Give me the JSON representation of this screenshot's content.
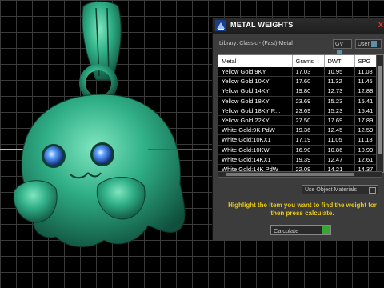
{
  "panel": {
    "title": "METAL WEIGHTS",
    "library": "Library: Classic - (Fast)-Metal",
    "gv_label": "GV",
    "user_label": "User",
    "close": "x"
  },
  "table": {
    "headers": [
      "Metal",
      "Grams",
      "DWT",
      "SPG"
    ],
    "rows": [
      [
        "Yellow Gold:9KY",
        "17.03",
        "10.95",
        "11.08"
      ],
      [
        "Yellow Gold:10KY",
        "17.60",
        "11.32",
        "11.45"
      ],
      [
        "Yellow Gold:14KY",
        "19.80",
        "12.73",
        "12.88"
      ],
      [
        "Yellow Gold:18KY",
        "23.69",
        "15.23",
        "15.41"
      ],
      [
        "Yellow Gold:18KY R...",
        "23.69",
        "15.23",
        "15.41"
      ],
      [
        "Yellow Gold:22KY",
        "27.50",
        "17.69",
        "17.89"
      ],
      [
        "White Gold:9K PdW",
        "19.36",
        "12.45",
        "12.59"
      ],
      [
        "White Gold:10KX1",
        "17.19",
        "11.05",
        "11.18"
      ],
      [
        "White Gold:10KW",
        "16.90",
        "10.86",
        "10.99"
      ],
      [
        "White Gold:14KX1",
        "19.39",
        "12.47",
        "12.61"
      ],
      [
        "White Gold:14K PdW",
        "22.09",
        "14.21",
        "14.37"
      ]
    ]
  },
  "use_object_materials": "Use Object Materials",
  "hint": "Highlight the item you want to find the weight for then press calculate.",
  "calculate": "Calculate",
  "colors": {
    "accent": "#e6c81a",
    "model": "#2fae86",
    "grid": "#3a3a3a"
  }
}
